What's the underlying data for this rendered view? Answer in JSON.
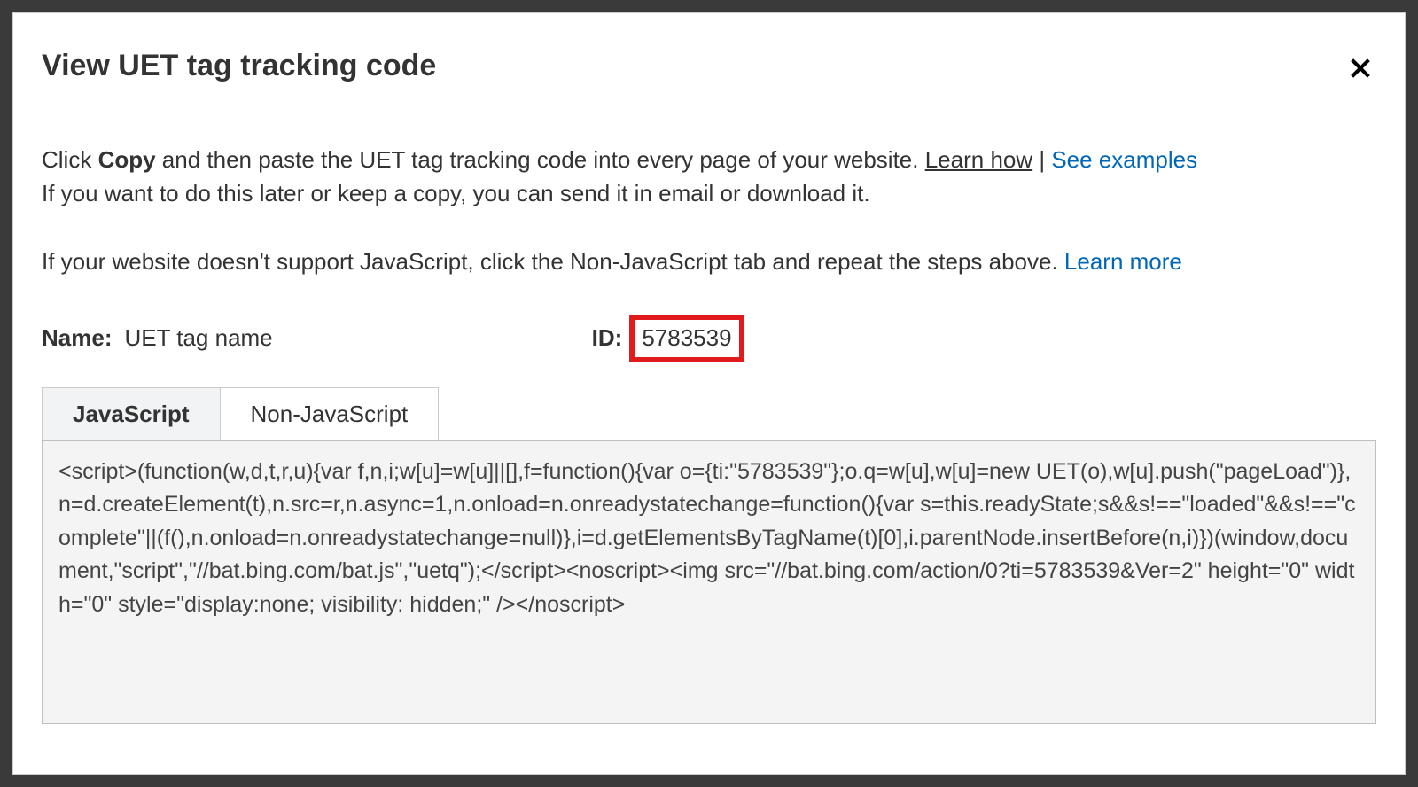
{
  "modal": {
    "title": "View UET tag tracking code",
    "close_icon": "✕",
    "para1": {
      "pre": "Click ",
      "bold": "Copy",
      "post": " and then paste the UET tag tracking code into every page of your website. ",
      "learn_how": "Learn how",
      "sep": " | ",
      "see_examples": "See examples",
      "line2": "If you want to do this later or keep a copy, you can send it in email or download it."
    },
    "para2": {
      "text": "If your website doesn't support JavaScript, click the Non-JavaScript tab and repeat the steps above. ",
      "learn_more": "Learn more"
    },
    "meta": {
      "name_label": "Name:",
      "name_value": "UET tag name",
      "id_label": "ID:",
      "id_value": "5783539"
    },
    "tabs": {
      "javascript": "JavaScript",
      "non_javascript": "Non-JavaScript"
    },
    "code": "<script>(function(w,d,t,r,u){var f,n,i;w[u]=w[u]||[],f=function(){var o={ti:\"5783539\"};o.q=w[u],w[u]=new UET(o),w[u].push(\"pageLoad\")},n=d.createElement(t),n.src=r,n.async=1,n.onload=n.onreadystatechange=function(){var s=this.readyState;s&&s!==\"loaded\"&&s!==\"complete\"||(f(),n.onload=n.onreadystatechange=null)},i=d.getElementsByTagName(t)[0],i.parentNode.insertBefore(n,i)})(window,document,\"script\",\"//bat.bing.com/bat.js\",\"uetq\");</script><noscript><img src=\"//bat.bing.com/action/0?ti=5783539&Ver=2\" height=\"0\" width=\"0\" style=\"display:none; visibility: hidden;\" /></noscript>"
  }
}
